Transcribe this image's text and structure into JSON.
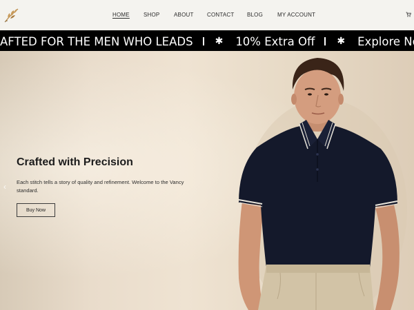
{
  "header": {
    "logo_icon": "leaf-logo-icon",
    "nav": [
      {
        "label": "HOME",
        "active": true
      },
      {
        "label": "SHOP",
        "active": false
      },
      {
        "label": "ABOUT",
        "active": false
      },
      {
        "label": "CONTACT",
        "active": false
      },
      {
        "label": "BLOG",
        "active": false
      },
      {
        "label": "MY ACCOUNT",
        "active": false
      }
    ],
    "cart_icon": "cart-icon"
  },
  "marquee": {
    "items": [
      "AFTED FOR THE MEN WHO LEADS",
      "10% Extra Off",
      "Explore Now"
    ],
    "separator_icon": "star-icon"
  },
  "hero": {
    "title": "Crafted with Precision",
    "subtitle": "Each stitch tells a story of quality and refinement. Welcome to the Vancy standard.",
    "cta_label": "Buy Now",
    "prev_icon": "chevron-left-icon"
  },
  "colors": {
    "marquee_bg": "#000000",
    "hero_bg": "#e9dccb",
    "shirt": "#14192b",
    "trousers": "#d2c3a6"
  }
}
